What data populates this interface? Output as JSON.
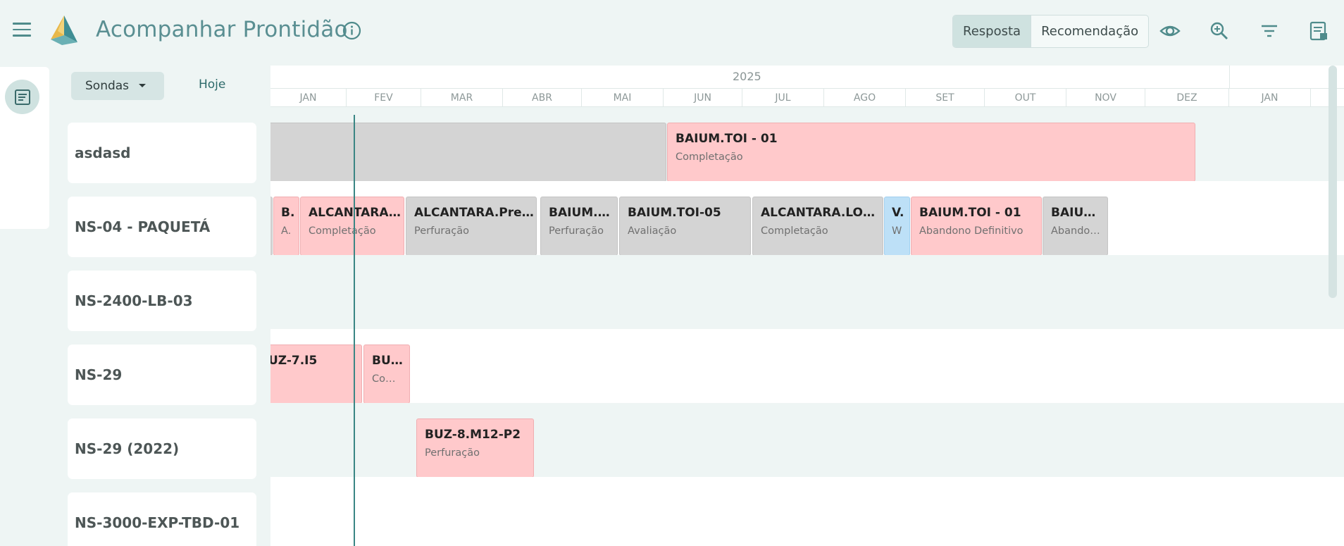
{
  "header": {
    "title": "Acompanhar Prontidão",
    "segments": [
      "Resposta",
      "Recomendação"
    ],
    "active_segment": "Resposta",
    "icons": [
      "menu-icon",
      "info-icon",
      "eye-icon",
      "zoom-in-icon",
      "filter-icon",
      "report-icon"
    ],
    "accent_color": "#5a8f92"
  },
  "controls": {
    "sondas_label": "Sondas",
    "hoje_label": "Hoje"
  },
  "timeline": {
    "year_current": "2025",
    "months": [
      "JAN",
      "FEV",
      "MAR",
      "ABR",
      "MAI",
      "JUN",
      "JUL",
      "AGO",
      "SET",
      "OUT",
      "NOV",
      "DEZ",
      "JAN"
    ]
  },
  "rows": [
    {
      "label": "asdasd",
      "bars": [
        {
          "title": "",
          "subtitle": "",
          "color": "gray"
        },
        {
          "title": "BAIUM.TOI - 01",
          "subtitle": "Completação",
          "color": "pink"
        }
      ]
    },
    {
      "label": "NS-04 - PAQUETÁ",
      "bars": [
        {
          "title": "",
          "subtitle": "",
          "color": "gray"
        },
        {
          "title": "B.",
          "subtitle": "A.",
          "color": "pink"
        },
        {
          "title": "ALCANTARA.…",
          "subtitle": "Completação",
          "color": "pink"
        },
        {
          "title": "ALCANTARA.Pref …",
          "subtitle": "Perfuração",
          "color": "gray"
        },
        {
          "title": "BAIUM.T…",
          "subtitle": "Perfuração",
          "color": "gray"
        },
        {
          "title": "BAIUM.TOI-05",
          "subtitle": "Avaliação",
          "color": "gray"
        },
        {
          "title": "ALCANTARA.LOC…",
          "subtitle": "Completação",
          "color": "gray"
        },
        {
          "title": "V.",
          "subtitle": "W",
          "color": "blue"
        },
        {
          "title": "BAIUM.TOI - 01",
          "subtitle": "Abandono Definitivo",
          "color": "pink"
        },
        {
          "title": "BAIU…",
          "subtitle": "Abando…",
          "color": "gray"
        }
      ]
    },
    {
      "label": "NS-2400-LB-03",
      "bars": []
    },
    {
      "label": "NS-29",
      "bars": [
        {
          "title": "UZ-7.I5",
          "subtitle": "",
          "color": "pink"
        },
        {
          "title": "BU…",
          "subtitle": "Co…",
          "color": "pink"
        }
      ]
    },
    {
      "label": "NS-29 (2022)",
      "bars": [
        {
          "title": "BUZ-8.M12-P2",
          "subtitle": "Perfuração",
          "color": "pink"
        }
      ]
    },
    {
      "label": "NS-3000-EXP-TBD-01",
      "bars": []
    }
  ]
}
